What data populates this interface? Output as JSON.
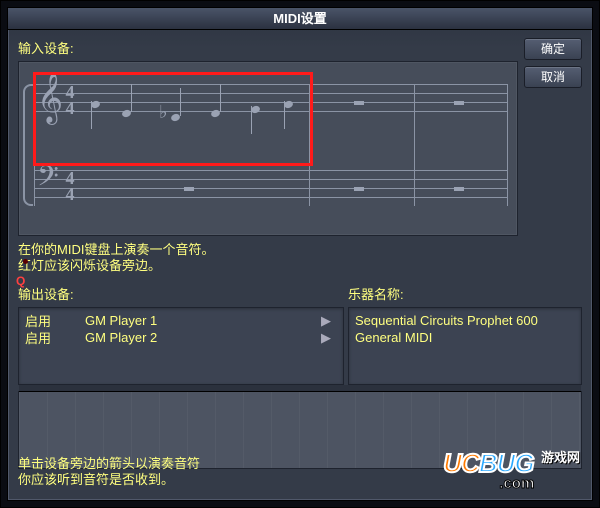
{
  "title": "MIDI设置",
  "buttons": {
    "ok": "确定",
    "cancel": "取消"
  },
  "input_devices_label": "输入设备:",
  "hint_top_line1": "在你的MIDI键盘上演奏一个音符。",
  "hint_top_line2": "红灯应该闪烁设备旁边。",
  "led_label": "Q",
  "output_devices_label": "输出设备:",
  "instrument_label": "乐器名称:",
  "output_rows": [
    {
      "enable": "启用",
      "player": "GM Player 1",
      "arrow": "▶"
    },
    {
      "enable": "启用",
      "player": "GM Player 2",
      "arrow": "▶"
    }
  ],
  "instrument_rows": [
    {
      "name": "Sequential Circuits Prophet 600"
    },
    {
      "name": "General MIDI"
    }
  ],
  "hint_bottom_line1": "单击设备旁边的箭头以演奏音符",
  "hint_bottom_line2": "你应该听到音符是否收到。",
  "timesig": {
    "top": "4",
    "bottom": "4"
  },
  "watermark": {
    "uc": "UC",
    "bug": "BUG",
    "side": "游戏网",
    "com": ".com"
  }
}
